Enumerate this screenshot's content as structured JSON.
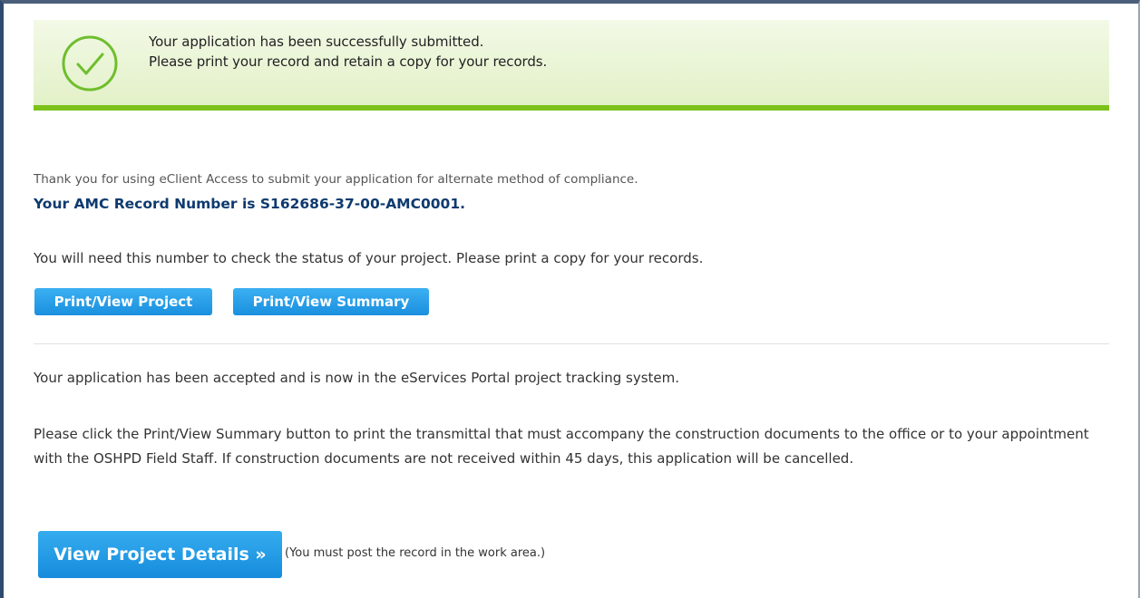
{
  "banner": {
    "line1": "Your application has been successfully submitted.",
    "line2": "Please print your record and retain a copy for your records.",
    "icon": "check-circle-icon",
    "accent_color": "#7cc21b"
  },
  "confirmation": {
    "thank_you": "Thank you for using eClient Access to submit your application for alternate method of compliance.",
    "record_number_text": "Your AMC Record Number is S162686-37-00-AMC0001.",
    "need_number": "You will need this number to check the status of your project. Please print a copy for your records."
  },
  "buttons": {
    "print_project": "Print/View Project",
    "print_summary": "Print/View Summary",
    "view_details": "View Project Details »"
  },
  "info": {
    "accepted": "Your application has been accepted and is now in the eServices Portal project tracking system.",
    "instructions": "Please click the Print/View Summary button to print the transmittal that must accompany the construction documents to the office or to your appointment with the OSHPD Field Staff. If construction documents are not received within 45 days, this application will be cancelled.",
    "post_note": "(You must post the record in the work area.)"
  },
  "colors": {
    "record_number": "#0e3a6f",
    "button": "#1a8fde"
  }
}
